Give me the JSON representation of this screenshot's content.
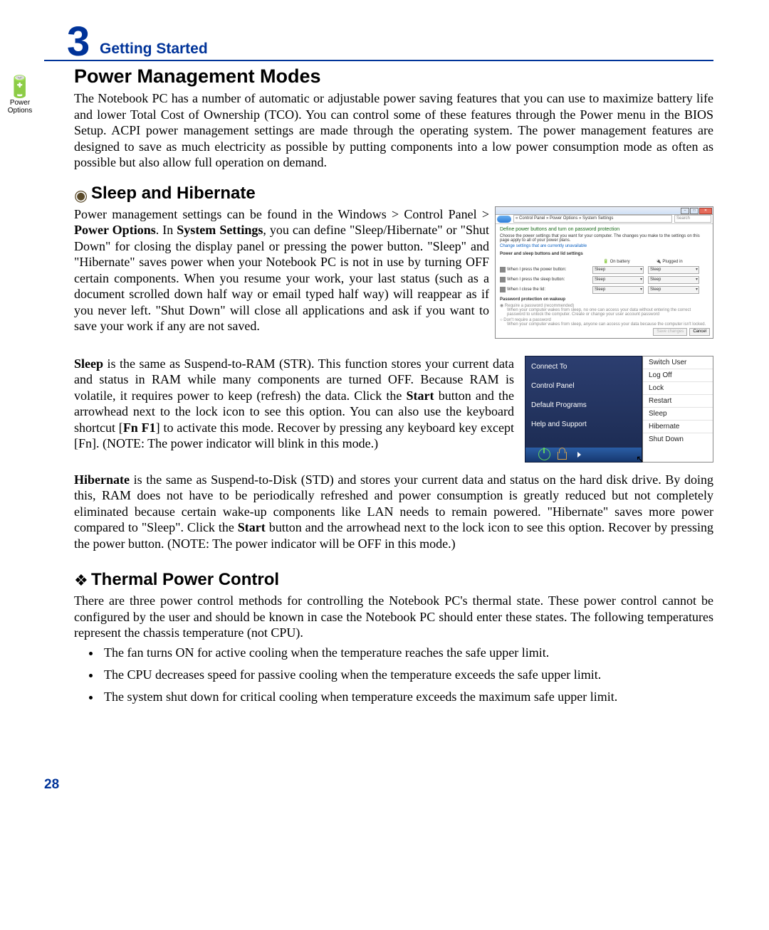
{
  "chapter": {
    "number": "3",
    "title": "Getting Started"
  },
  "sidebar_icon": {
    "glyph": "🔋",
    "caption_line1": "Power",
    "caption_line2": "Options"
  },
  "s1_title": "Power Management Modes",
  "s1_p1": "The Notebook PC has a number of automatic or adjustable power saving features that you can use to maximize battery life and lower Total Cost of Ownership (TCO). You can control some of these features through the Power menu in the BIOS Setup. ACPI power management settings are made through the operating system. The power management features are designed to save as much electricity as possible by putting components into a low power consumption mode as often as possible but also allow full operation on demand.",
  "s2_icon": "◉",
  "s2_title": "Sleep and Hibernate",
  "s2_p1_a": "Power management settings can be found in the Windows > Control Panel > ",
  "s2_p1_b1": "Power Options",
  "s2_p1_c": ". In ",
  "s2_p1_b2": "System Settings",
  "s2_p1_d": ", you can define \"Sleep/Hibernate\" or \"Shut Down\" for closing the display panel or pressing the power button. \"Sleep\" and \"Hibernate\" saves power when your Notebook PC is not in use by turning OFF certain components. When you resume your work, your last status (such as a document scrolled down half way or email typed half way) will reappear as if you never left. \"Shut Down\" will close all applications and ask if you want to save your work if any are not saved.",
  "s2_p2_b1": "Sleep",
  "s2_p2_a": " is the same as Suspend-to-RAM (STR). This function stores your current data and status in RAM while many components are turned OFF. Because RAM is volatile, it requires power to keep (refresh) the data. Click the ",
  "s2_p2_b2": "Start",
  "s2_p2_c": " button and the arrowhead next to the lock icon to see this option. You can also use the keyboard shortcut [",
  "s2_p2_b3": "Fn F1",
  "s2_p2_d": "] to activate this mode. Recover by pressing any keyboard key except [Fn]. (NOTE: The power indicator will blink in this mode.)",
  "s2_p3_b1": "Hibernate",
  "s2_p3_a": " is the same as  Suspend-to-Disk (STD) and stores your current data and status on the hard disk drive. By doing this, RAM does not have to be periodically refreshed and power consumption is greatly reduced but not completely eliminated because certain wake-up components like LAN needs to remain powered. \"Hibernate\" saves more power compared to \"Sleep\". Click the ",
  "s2_p3_b2": "Start",
  "s2_p3_b": " button and the arrowhead next to the lock icon to see this option. Recover by pressing the power button. (NOTE: The power indicator will be OFF in this mode.)",
  "s3_icon": "❖",
  "s3_title": "Thermal Power Control",
  "s3_p1": "There are three power control methods for controlling the Notebook PC's thermal state. These power control cannot be configured by the user and should be known in case the Notebook PC should enter these states. The following temperatures represent the chassis temperature (not CPU).",
  "s3_li1": "The fan turns ON for active cooling when the temperature reaches the safe upper limit.",
  "s3_li2": "The CPU decreases speed for passive cooling when the temperature exceeds the safe upper limit.",
  "s3_li3": "The system shut down for critical cooling when temperature exceeds the maximum safe upper limit.",
  "page_number": "28",
  "shot1": {
    "crumbs": "« Control Panel » Power Options » System Settings",
    "search": "Search",
    "heading": "Define power buttons and turn on password protection",
    "sub": "Choose the power settings that you want for your computer. The changes you make to the settings on this page apply to all of your power plans.",
    "link": "Change settings that are currently unavailable",
    "sect1": "Power and sleep buttons and lid settings",
    "col1": "On battery",
    "col2": "Plugged in",
    "row1": "When I press the power button:",
    "row2": "When I press the sleep button:",
    "row3": "When I close the lid:",
    "dd": "Sleep",
    "sect2": "Password protection on wakeup",
    "opt1": "Require a password (recommended)",
    "opt1txt": "When your computer wakes from sleep, no one can access your data without entering the correct password to unlock the computer. Create or change your user account password",
    "opt2": "Don't require a password",
    "opt2txt": "When your computer wakes from sleep, anyone can access your data because the computer isn't locked.",
    "btn_save": "Save changes",
    "btn_cancel": "Cancel"
  },
  "shot2": {
    "left": [
      "Connect To",
      "Control Panel",
      "Default Programs",
      "Help and Support"
    ],
    "right": [
      "Switch User",
      "Log Off",
      "Lock",
      "Restart",
      "Sleep",
      "Hibernate",
      "Shut Down"
    ]
  }
}
